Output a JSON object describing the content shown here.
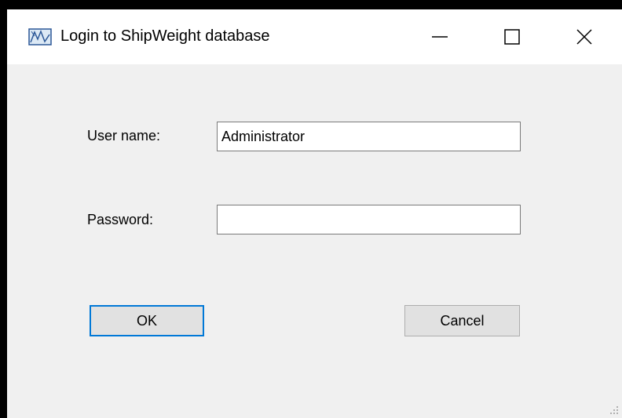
{
  "window": {
    "title": "Login to ShipWeight database",
    "icon": "chart-app-icon",
    "controls": {
      "minimize_icon": "minimize-icon",
      "maximize_icon": "maximize-icon",
      "close_icon": "close-icon"
    }
  },
  "form": {
    "username_label": "User name:",
    "username_value": "Administrator",
    "password_label": "Password:",
    "password_value": ""
  },
  "buttons": {
    "ok_label": "OK",
    "cancel_label": "Cancel"
  },
  "colors": {
    "focus_accent": "#0078d7",
    "window_bg": "#f0f0f0",
    "titlebar_bg": "#ffffff",
    "button_bg": "#e1e1e1"
  }
}
